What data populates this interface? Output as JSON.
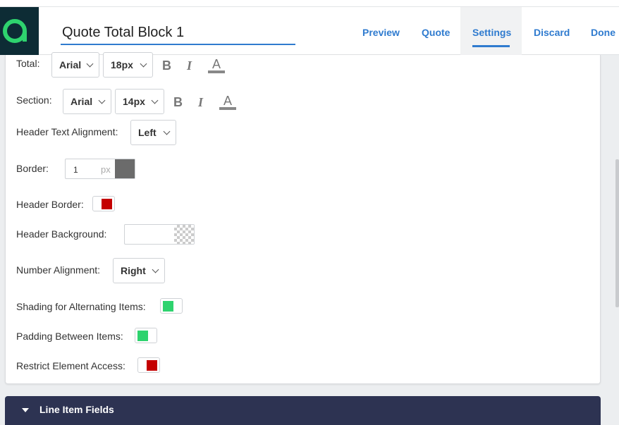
{
  "header": {
    "title": "Quote Total Block 1",
    "nav": [
      {
        "label": "Preview"
      },
      {
        "label": "Quote"
      },
      {
        "label": "Settings",
        "active": true
      },
      {
        "label": "Discard"
      },
      {
        "label": "Done"
      }
    ]
  },
  "settings": {
    "total": {
      "label": "Total:",
      "font": "Arial",
      "size": "18px"
    },
    "section": {
      "label": "Section:",
      "font": "Arial",
      "size": "14px"
    },
    "header_text_alignment": {
      "label": "Header Text Alignment:",
      "value": "Left"
    },
    "border": {
      "label": "Border:",
      "value": "1",
      "unit": "px",
      "color": "#6b6b6b"
    },
    "header_border": {
      "label": "Header Border:",
      "enabled": false
    },
    "header_background": {
      "label": "Header Background:",
      "value": ""
    },
    "number_alignment": {
      "label": "Number Alignment:",
      "value": "Right"
    },
    "shading": {
      "label": "Shading for Alternating Items:",
      "enabled": true
    },
    "padding": {
      "label": "Padding Between Items:",
      "enabled": true
    },
    "restrict": {
      "label": "Restrict Element Access:",
      "enabled": false
    }
  },
  "format_buttons": {
    "bold": "B",
    "italic": "I",
    "color": "A"
  },
  "section_bar": {
    "label": "Line Item Fields"
  },
  "colors": {
    "accent": "#2f7bcf",
    "logo_bg": "#0d2c35",
    "logo_fg": "#2ed36e",
    "bar_bg": "#2d3352",
    "toggle_on": "#2ed36e",
    "toggle_off": "#c40000"
  }
}
